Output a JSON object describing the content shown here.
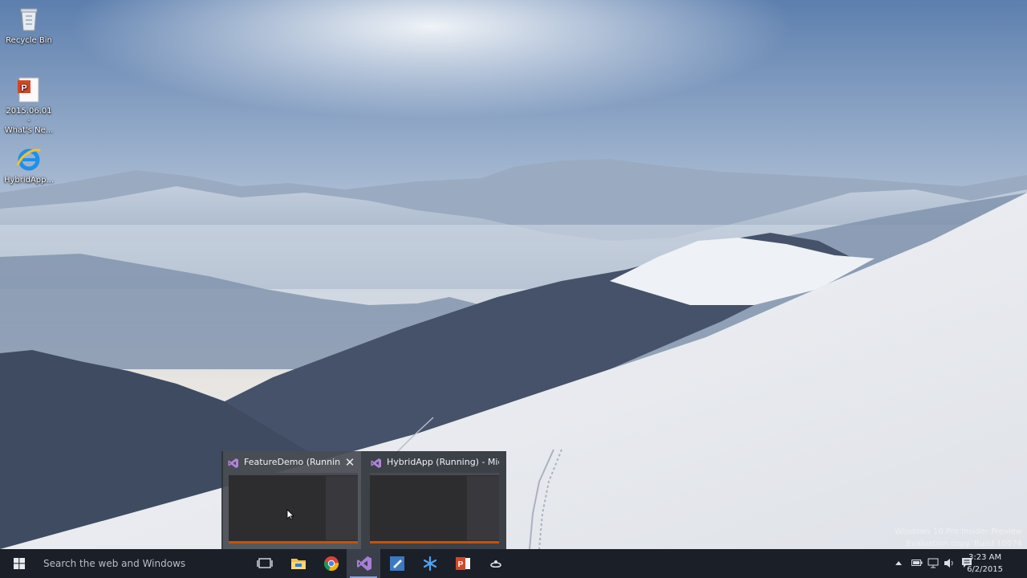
{
  "desktop": {
    "icons": [
      {
        "name": "recycle-bin-icon",
        "label": "Recycle Bin"
      },
      {
        "name": "powerpoint-file-icon",
        "label": "2015.06.01 -\nWhat's Ne..."
      },
      {
        "name": "internet-explorer-icon",
        "label": "HybridApp..."
      }
    ],
    "watermark": {
      "line1": "Windows 10 Pro Insider Preview",
      "line2": "Evaluation copy. Build 10074"
    }
  },
  "taskbar": {
    "start_icon": "windows-logo-icon",
    "search_placeholder": "Search the web and Windows",
    "pinned": [
      {
        "name": "task-view-icon"
      },
      {
        "name": "file-explorer-icon"
      },
      {
        "name": "chrome-icon"
      },
      {
        "name": "visual-studio-icon",
        "active": true
      },
      {
        "name": "blend-icon"
      },
      {
        "name": "snowflake-app-icon"
      },
      {
        "name": "powerpoint-icon"
      },
      {
        "name": "app-icon"
      }
    ],
    "tray": {
      "show_hidden_icon": "chevron-up-icon",
      "icons": [
        "battery-icon",
        "network-icon",
        "volume-icon",
        "action-center-icon"
      ],
      "time": "3:23 AM",
      "date": "6/2/2015"
    }
  },
  "thumbnails": [
    {
      "title": "FeatureDemo (Running) -...",
      "hovered": true,
      "close_label": "✕"
    },
    {
      "title": "HybridApp (Running) - Microso...",
      "hovered": false
    }
  ],
  "colors": {
    "taskbar": "#1b1f27",
    "vs_purple": "#68217a",
    "thumb_accent": "#ca5100"
  }
}
